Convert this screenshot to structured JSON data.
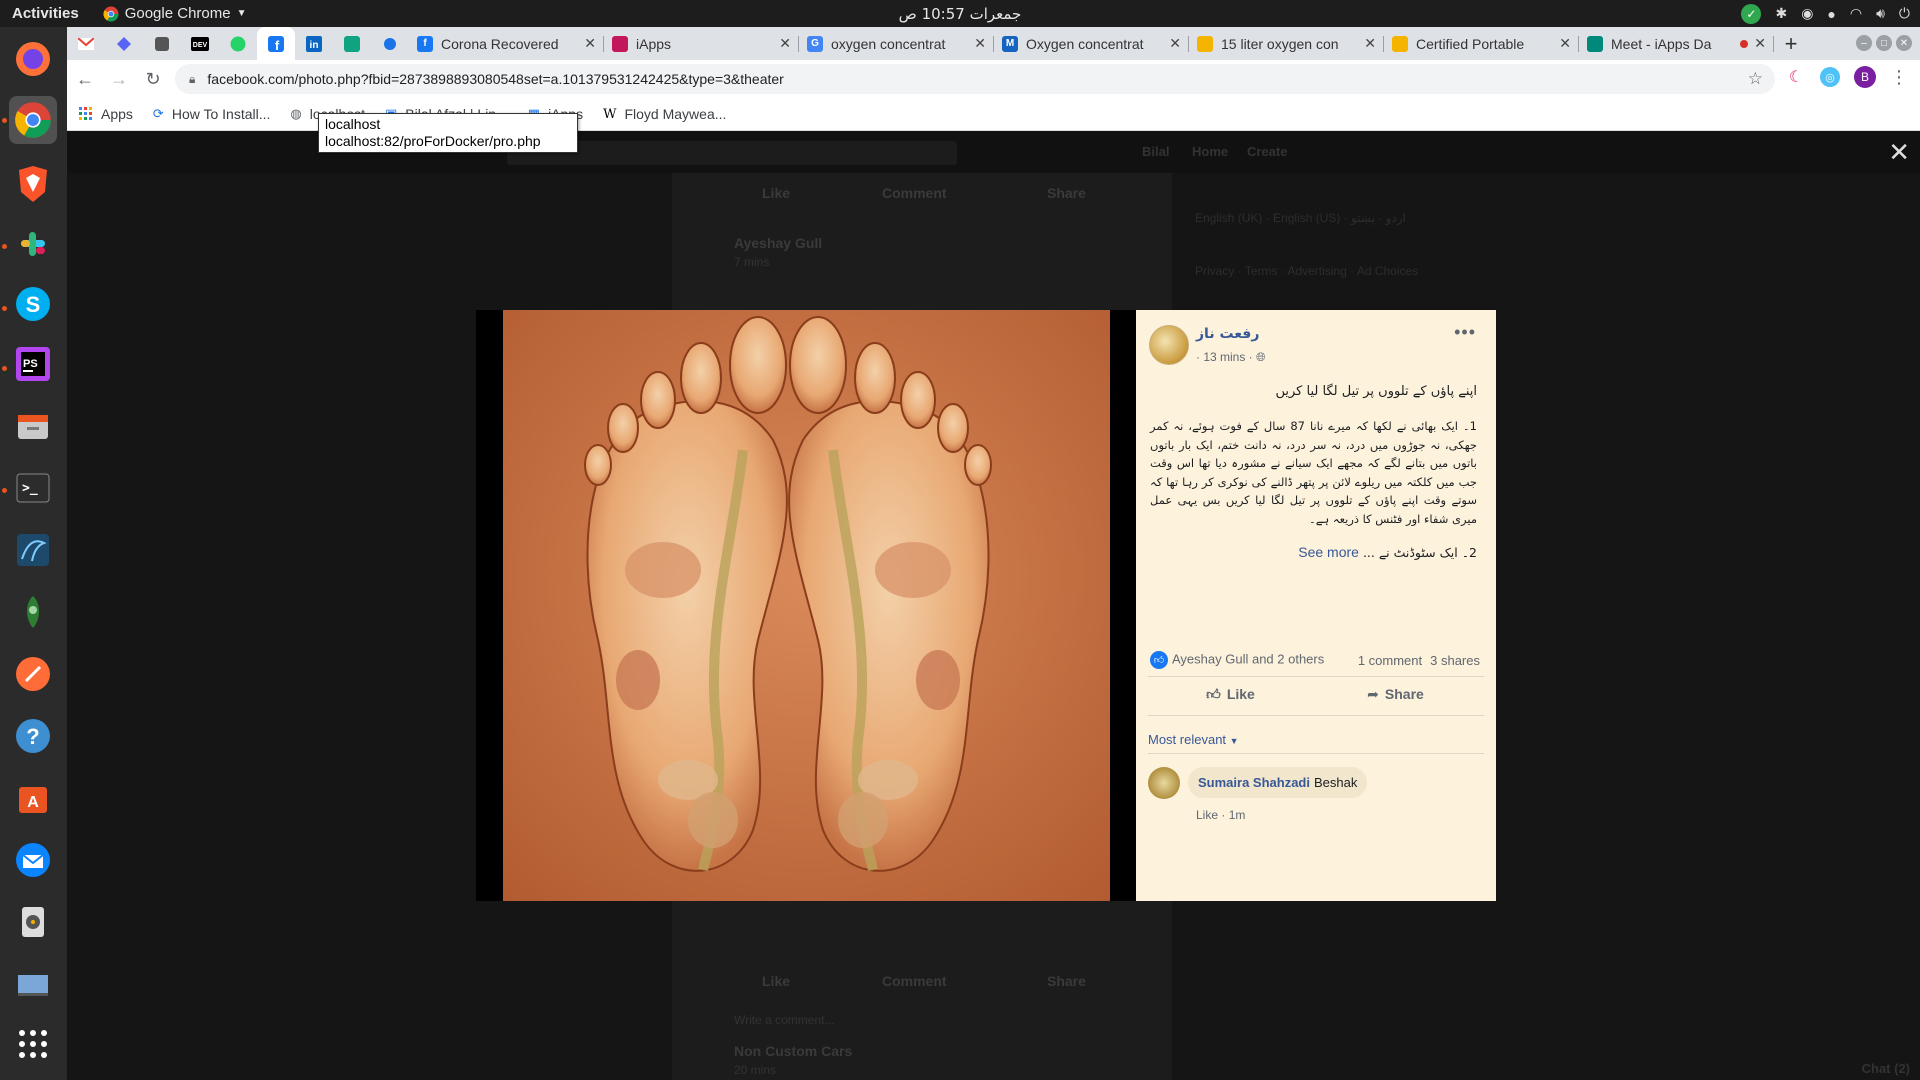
{
  "system": {
    "activities": "Activities",
    "app_name": "Google Chrome",
    "clock": "جمعرات 10:57 ص"
  },
  "browser": {
    "tabs": [
      {
        "title": "Corona Recovered",
        "favicon_color": "#1877f2"
      },
      {
        "title": "iApps",
        "favicon_color": "#c2185b"
      },
      {
        "title": "oxygen concentrat",
        "favicon_color": "#4285f4"
      },
      {
        "title": "Oxygen concentrat",
        "favicon_color": "#1565c0"
      },
      {
        "title": "15 liter oxygen con",
        "favicon_color": "#f4b400"
      },
      {
        "title": "Certified Portable",
        "favicon_color": "#f4b400"
      },
      {
        "title": "Meet - iApps Da",
        "favicon_color": "#00897b"
      }
    ],
    "url": "facebook.com/photo.php?fbid=2873898893080548set=a.101379531242425&type=3&theater",
    "bookmarks": [
      "Apps",
      "How To Install...",
      "localhost",
      "Bilal Afzal | Lin...",
      "iApps",
      "Floyd Maywea..."
    ],
    "tooltip": {
      "title": "localhost",
      "url": "localhost:82/proForDocker/pro.php"
    }
  },
  "background_page": {
    "nav_user": "Bilal",
    "nav_home": "Home",
    "nav_create": "Create",
    "post_actions": [
      "Like",
      "Comment",
      "Share"
    ],
    "post_author": "Ayeshay Gull",
    "post_time": "7 mins",
    "comment_placeholder": "Write a comment...",
    "next_author": "Non Custom Cars",
    "next_time": "20 mins",
    "languages": "English (UK) · English (US) · اردو · پښتو",
    "footer_links": "Privacy · Terms · Advertising · Ad Choices",
    "chat": "Chat (2)"
  },
  "post": {
    "author": "رفعت ناز",
    "time": "· 13 mins ·",
    "line1": "اپنے پاؤں کے تلووں پر تیل لگا لیا کریں",
    "body": "1۔ ایک بھائی نے لکھا کہ میرے نانا 87 سال کے فوت ہوئے، نہ کمر جھکی، نہ جوڑوں میں درد، نہ سر درد، نہ دانت ختم، ایک بار باتوں باتوں میں بتانے لگے کہ مجھے ایک سیانے نے مشورہ دیا تھا اس وقت جب میں کلکتہ میں ریلوے لائن پر پتھر ڈالنے کی نوکری کر رہا تھا کہ سوتے وقت اپنے پاؤں کے تلووں پر تیل لگا لیا کریں بس یہی عمل میری شفاء اور فٹنس کا ذریعہ ہے۔",
    "item2": "2۔ ایک سٹوڈنٹ نے ...",
    "see_more": "See more",
    "reactions": "Ayeshay Gull and 2 others",
    "comments_count": "1 comment",
    "shares_count": "3 shares",
    "like_label": "Like",
    "share_label": "Share",
    "sort_label": "Most relevant",
    "comment": {
      "author": "Sumaira Shahzadi",
      "text": "Beshak",
      "like": "Like",
      "time": "1m"
    }
  },
  "colors": {
    "panel_bg": "#fdf2dc",
    "link_blue": "#385898",
    "photo_bg": "#d5784e"
  }
}
